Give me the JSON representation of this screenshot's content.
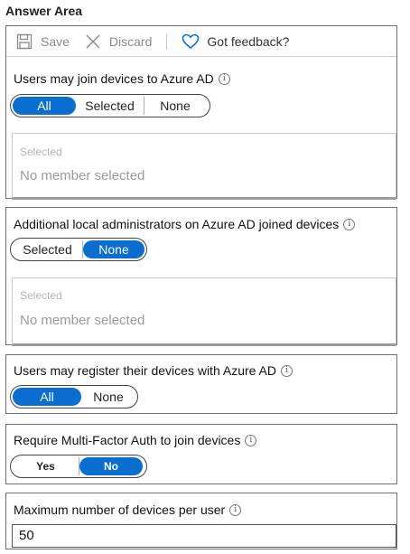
{
  "title": "Answer Area",
  "toolbar": {
    "save_label": "Save",
    "discard_label": "Discard",
    "feedback_label": "Got feedback?"
  },
  "join_devices": {
    "label": "Users may join devices to Azure AD",
    "options": [
      "All",
      "Selected",
      "None"
    ],
    "selected": "All",
    "selected_header": "Selected",
    "member_text": "No member selected"
  },
  "local_admins": {
    "label": "Additional local administrators on Azure AD joined devices",
    "options": [
      "Selected",
      "None"
    ],
    "selected": "None",
    "selected_header": "Selected",
    "member_text": "No member selected"
  },
  "register_devices": {
    "label": "Users may register their devices with Azure AD",
    "options": [
      "All",
      "None"
    ],
    "selected": "All"
  },
  "mfa": {
    "label": "Require Multi-Factor Auth to join devices",
    "options": [
      "Yes",
      "No"
    ],
    "selected": "No"
  },
  "max_devices": {
    "label": "Maximum number of devices per user",
    "value": "50"
  },
  "colors": {
    "accent": "#0a6ed1",
    "border": "#6f6f6f",
    "muted_text": "#9b9b9b"
  },
  "icons": [
    "save-icon",
    "discard-icon",
    "heart-icon",
    "info-icon"
  ]
}
